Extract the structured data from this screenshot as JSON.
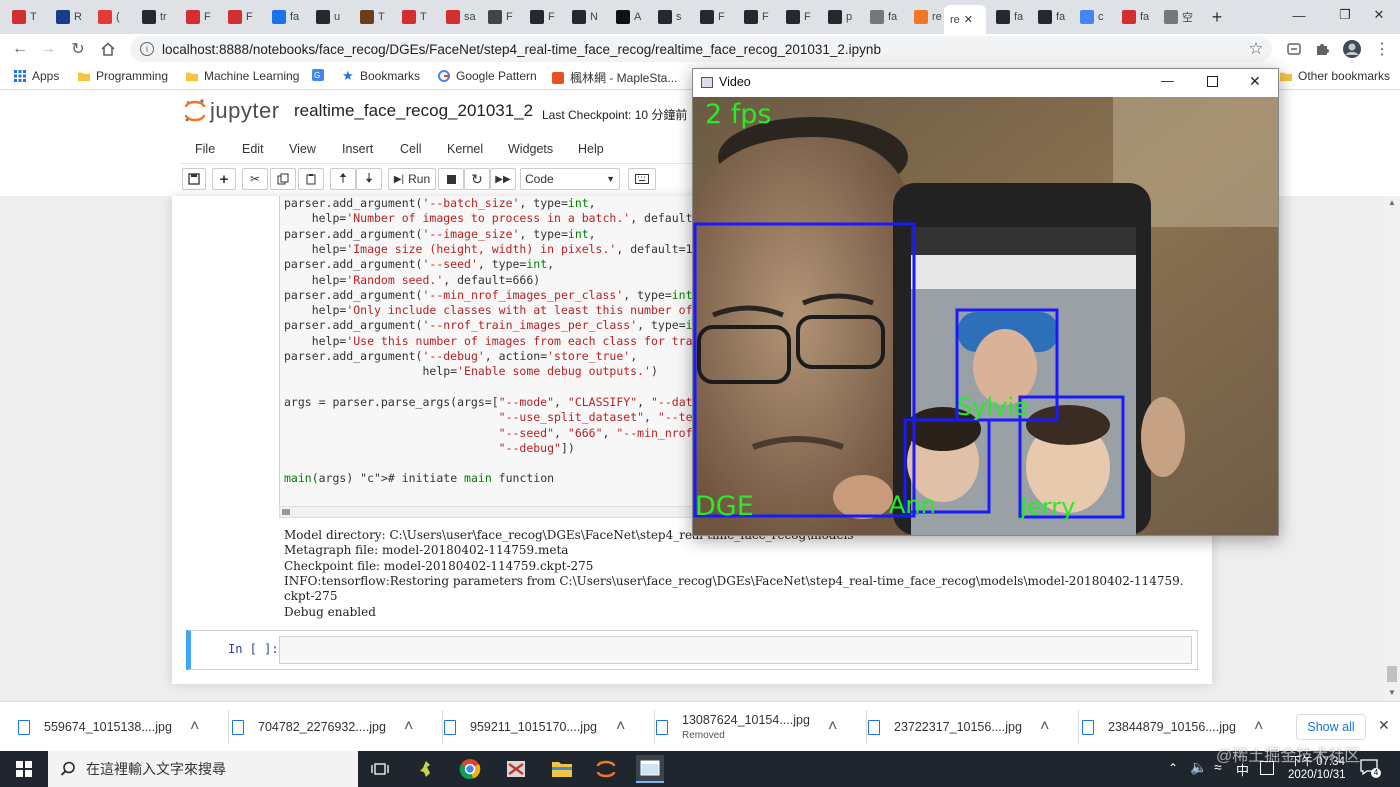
{
  "tabs": [
    "T",
    "R",
    "(",
    "tr",
    "F",
    "F",
    "fa",
    "u",
    "T",
    "T",
    "sa",
    "F",
    "F",
    "N",
    "A",
    "s",
    "F",
    "F",
    "F",
    "p",
    "fa",
    "re",
    "fa",
    "fa",
    "c",
    "fa",
    "空"
  ],
  "active_tab_label": "re",
  "new_tab_symbol": "+",
  "address": {
    "url": "localhost:8888/notebooks/face_recog/DGEs/FaceNet/step4_real-time_face_recog/realtime_face_recog_201031_2.ipynb"
  },
  "bookmarks": {
    "items": [
      "Apps",
      "Programming",
      "Machine Learning",
      "Bookmarks",
      "Google Pattern",
      "楓林網 - MapleSta..."
    ],
    "other": "Other bookmarks"
  },
  "jupyter": {
    "logo": "jupyter",
    "title": "realtime_face_recog_201031_2",
    "checkpoint": "Last Checkpoint: 10 分鐘前",
    "menu": [
      "File",
      "Edit",
      "View",
      "Insert",
      "Cell",
      "Kernel",
      "Widgets",
      "Help"
    ],
    "run_label": "Run",
    "cell_type": "Code"
  },
  "code_lines": [
    "parser.add_argument('--batch_size', type=int,",
    "    help='Number of images to process in a batch.', default=90)",
    "parser.add_argument('--image_size', type=int,",
    "    help='Image size (height, width) in pixels.', default=160)",
    "parser.add_argument('--seed', type=int,",
    "    help='Random seed.', default=666)",
    "parser.add_argument('--min_nrof_images_per_class', type=int,",
    "    help='Only include classes with at least this number of im",
    "parser.add_argument('--nrof_train_images_per_class', type=int,",
    "    help='Use this number of images from each class for traini",
    "parser.add_argument('--debug', action='store_true',",
    "                    help='Enable some debug outputs.')",
    "",
    "args = parser.parse_args(args=[\"--mode\", \"CLASSIFY\", \"--data_d",
    "                               \"--use_split_dataset\", \"--test_",
    "                               \"--seed\", \"666\", \"--min_nrof_im",
    "                               \"--debug\"])",
    "",
    "main(args) # initiate main function"
  ],
  "output_lines": [
    "Model directory: C:\\Users\\user\\face_recog\\DGEs\\FaceNet\\step4_real-time_face_recog\\models",
    "Metagraph file: model-20180402-114759.meta",
    "Checkpoint file: model-20180402-114759.ckpt-275",
    "INFO:tensorflow:Restoring parameters from C:\\Users\\user\\face_recog\\DGEs\\FaceNet\\step4_real-time_face_recog\\models\\model-20180402-114759.",
    "ckpt-275",
    "Debug enabled"
  ],
  "in_prompt": "In [ ]:",
  "video": {
    "title": "Video",
    "fps": "2 fps",
    "labels": [
      "DGE",
      "Sylvie",
      "Ann",
      "Jerry"
    ],
    "box_color": "#1a1aff",
    "label_color": "#22ee22"
  },
  "downloads": {
    "items": [
      {
        "name": "559674_1015138....jpg",
        "status": ""
      },
      {
        "name": "704782_2276932....jpg",
        "status": ""
      },
      {
        "name": "959211_1015170....jpg",
        "status": ""
      },
      {
        "name": "13087624_10154....jpg",
        "status": "Removed"
      },
      {
        "name": "23722317_10156....jpg",
        "status": ""
      },
      {
        "name": "23844879_10156....jpg",
        "status": ""
      }
    ],
    "show_all": "Show all"
  },
  "taskbar": {
    "search_placeholder": "在這裡輸入文字來搜尋",
    "ime": "中",
    "time": "下午 07:34",
    "date": "2020/10/31",
    "notifications": "4"
  },
  "watermark": "@稀土掘金技术社区"
}
